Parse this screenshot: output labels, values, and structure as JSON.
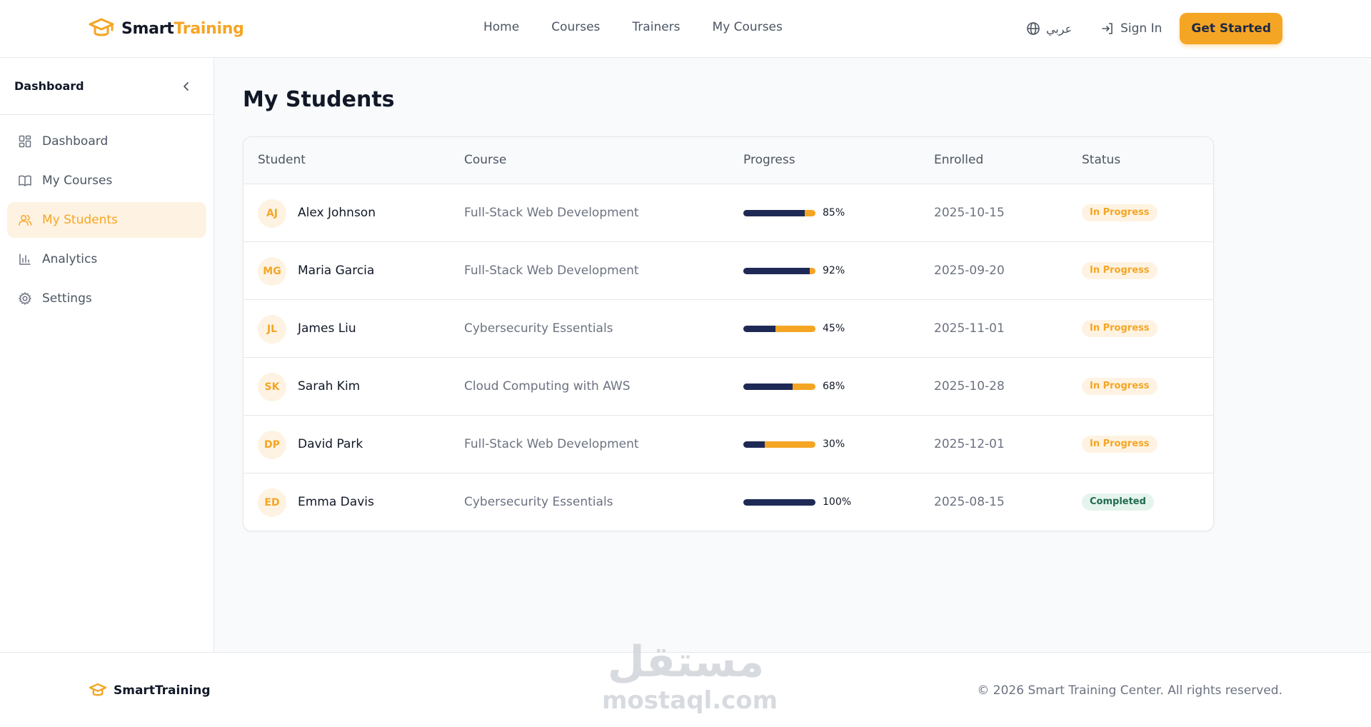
{
  "header": {
    "brand_part1": "Smart",
    "brand_part2": "Training",
    "nav": [
      "Home",
      "Courses",
      "Trainers",
      "My Courses"
    ],
    "language": "عربي",
    "signin": "Sign In",
    "cta": "Get Started"
  },
  "sidebar": {
    "title": "Dashboard",
    "items": [
      {
        "label": "Dashboard",
        "icon": "dashboard-icon",
        "active": false
      },
      {
        "label": "My Courses",
        "icon": "book-icon",
        "active": false
      },
      {
        "label": "My Students",
        "icon": "users-icon",
        "active": true
      },
      {
        "label": "Analytics",
        "icon": "chart-icon",
        "active": false
      },
      {
        "label": "Settings",
        "icon": "gear-icon",
        "active": false
      }
    ]
  },
  "main": {
    "title": "My Students",
    "columns": [
      "Student",
      "Course",
      "Progress",
      "Enrolled",
      "Status"
    ],
    "rows": [
      {
        "initials": "AJ",
        "name": "Alex Johnson",
        "course": "Full-Stack Web Development",
        "progress": 85,
        "progress_label": "85%",
        "enrolled": "2025-10-15",
        "status": "In Progress",
        "status_kind": "prog"
      },
      {
        "initials": "MG",
        "name": "Maria Garcia",
        "course": "Full-Stack Web Development",
        "progress": 92,
        "progress_label": "92%",
        "enrolled": "2025-09-20",
        "status": "In Progress",
        "status_kind": "prog"
      },
      {
        "initials": "JL",
        "name": "James Liu",
        "course": "Cybersecurity Essentials",
        "progress": 45,
        "progress_label": "45%",
        "enrolled": "2025-11-01",
        "status": "In Progress",
        "status_kind": "prog"
      },
      {
        "initials": "SK",
        "name": "Sarah Kim",
        "course": "Cloud Computing with AWS",
        "progress": 68,
        "progress_label": "68%",
        "enrolled": "2025-10-28",
        "status": "In Progress",
        "status_kind": "prog"
      },
      {
        "initials": "DP",
        "name": "David Park",
        "course": "Full-Stack Web Development",
        "progress": 30,
        "progress_label": "30%",
        "enrolled": "2025-12-01",
        "status": "In Progress",
        "status_kind": "prog"
      },
      {
        "initials": "ED",
        "name": "Emma Davis",
        "course": "Cybersecurity Essentials",
        "progress": 100,
        "progress_label": "100%",
        "enrolled": "2025-08-15",
        "status": "Completed",
        "status_kind": "done"
      }
    ]
  },
  "footer": {
    "brand": "SmartTraining",
    "copyright": "© 2026 Smart Training Center. All rights reserved.",
    "watermark_ar": "مستقل",
    "watermark_en": "mostaql.com"
  },
  "colors": {
    "accent": "#f5a524",
    "navy": "#1e2a55",
    "completed_bg": "#e6f4ee"
  }
}
